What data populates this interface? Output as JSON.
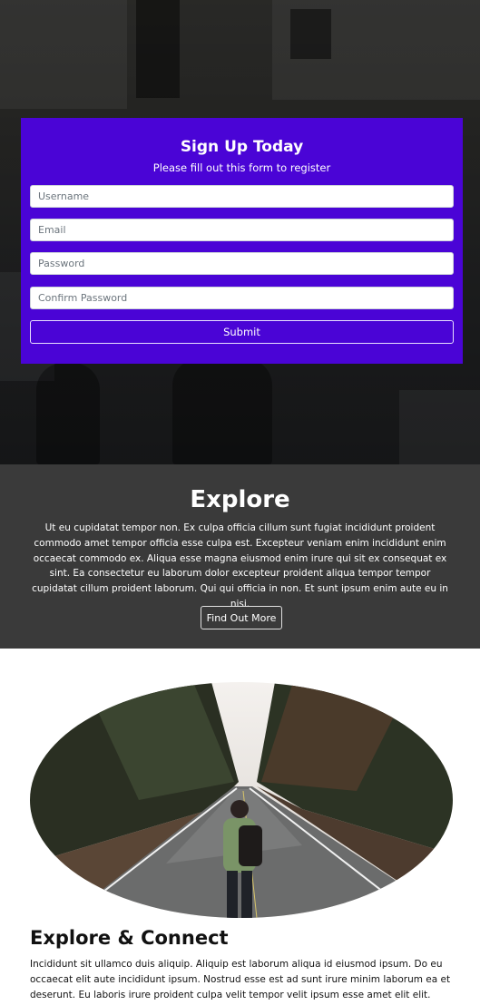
{
  "signup": {
    "title": "Sign Up Today",
    "subtitle": "Please fill out this form to register",
    "fields": {
      "username_placeholder": "Username",
      "email_placeholder": "Email",
      "password_placeholder": "Password",
      "confirm_placeholder": "Confirm Password"
    },
    "submit_label": "Submit",
    "card_color": "#4a04d6"
  },
  "explore": {
    "title": "Explore",
    "text": "Ut eu cupidatat tempor non. Ex culpa officia cillum sunt fugiat incididunt proident commodo amet tempor officia esse culpa est. Excepteur veniam enim incididunt enim occaecat commodo ex. Aliqua esse magna eiusmod enim irure qui sit ex consequat ex sint. Ea consectetur eu laborum dolor excepteur proident aliqua tempor tempor cupidatat cillum proident laborum. Qui qui officia in non. Et sunt ipsum enim aute eu in nisi.",
    "button_label": "Find Out More"
  },
  "connect": {
    "title": "Explore & Connect",
    "text": "Incididunt sit ullamco duis aliquip. Aliquip est laborum aliqua id eiusmod ipsum. Do eu occaecat elit aute incididunt ipsum. Nostrud esse est ad sunt irure minim laborum ea et deserunt. Eu laboris irure proident culpa velit tempor velit ipsum esse amet elit elit."
  }
}
